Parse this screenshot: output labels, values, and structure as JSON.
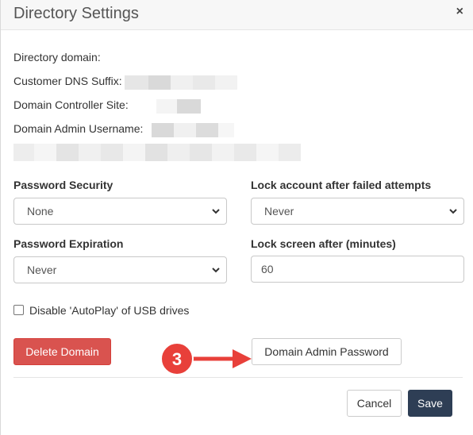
{
  "dialog": {
    "title": "Directory Settings",
    "close_glyph": "×"
  },
  "info": {
    "directory_domain_label": "Directory domain:",
    "dns_suffix_label": "Customer DNS Suffix:",
    "dc_site_label": "Domain Controller Site:",
    "admin_username_label": "Domain Admin Username:"
  },
  "password_security": {
    "label": "Password Security",
    "selected": "None"
  },
  "lock_account": {
    "label": "Lock account after failed attempts",
    "selected": "Never"
  },
  "password_expiration": {
    "label": "Password Expiration",
    "selected": "Never"
  },
  "lock_screen": {
    "label": "Lock screen after (minutes)",
    "value": "60"
  },
  "autoplay": {
    "label": "Disable 'AutoPlay' of USB drives",
    "checked": false
  },
  "actions": {
    "delete_domain": "Delete Domain",
    "domain_admin_password": "Domain Admin Password",
    "cancel": "Cancel",
    "save": "Save"
  },
  "annotation": {
    "step_number": "3",
    "color": "#e8403a"
  },
  "colors": {
    "danger": "#d9534f",
    "primary": "#2e3e55",
    "header_bg": "#f7f7f7",
    "redaction_light": "#f2f2f2",
    "redaction_dark": "#d9d9d9"
  }
}
